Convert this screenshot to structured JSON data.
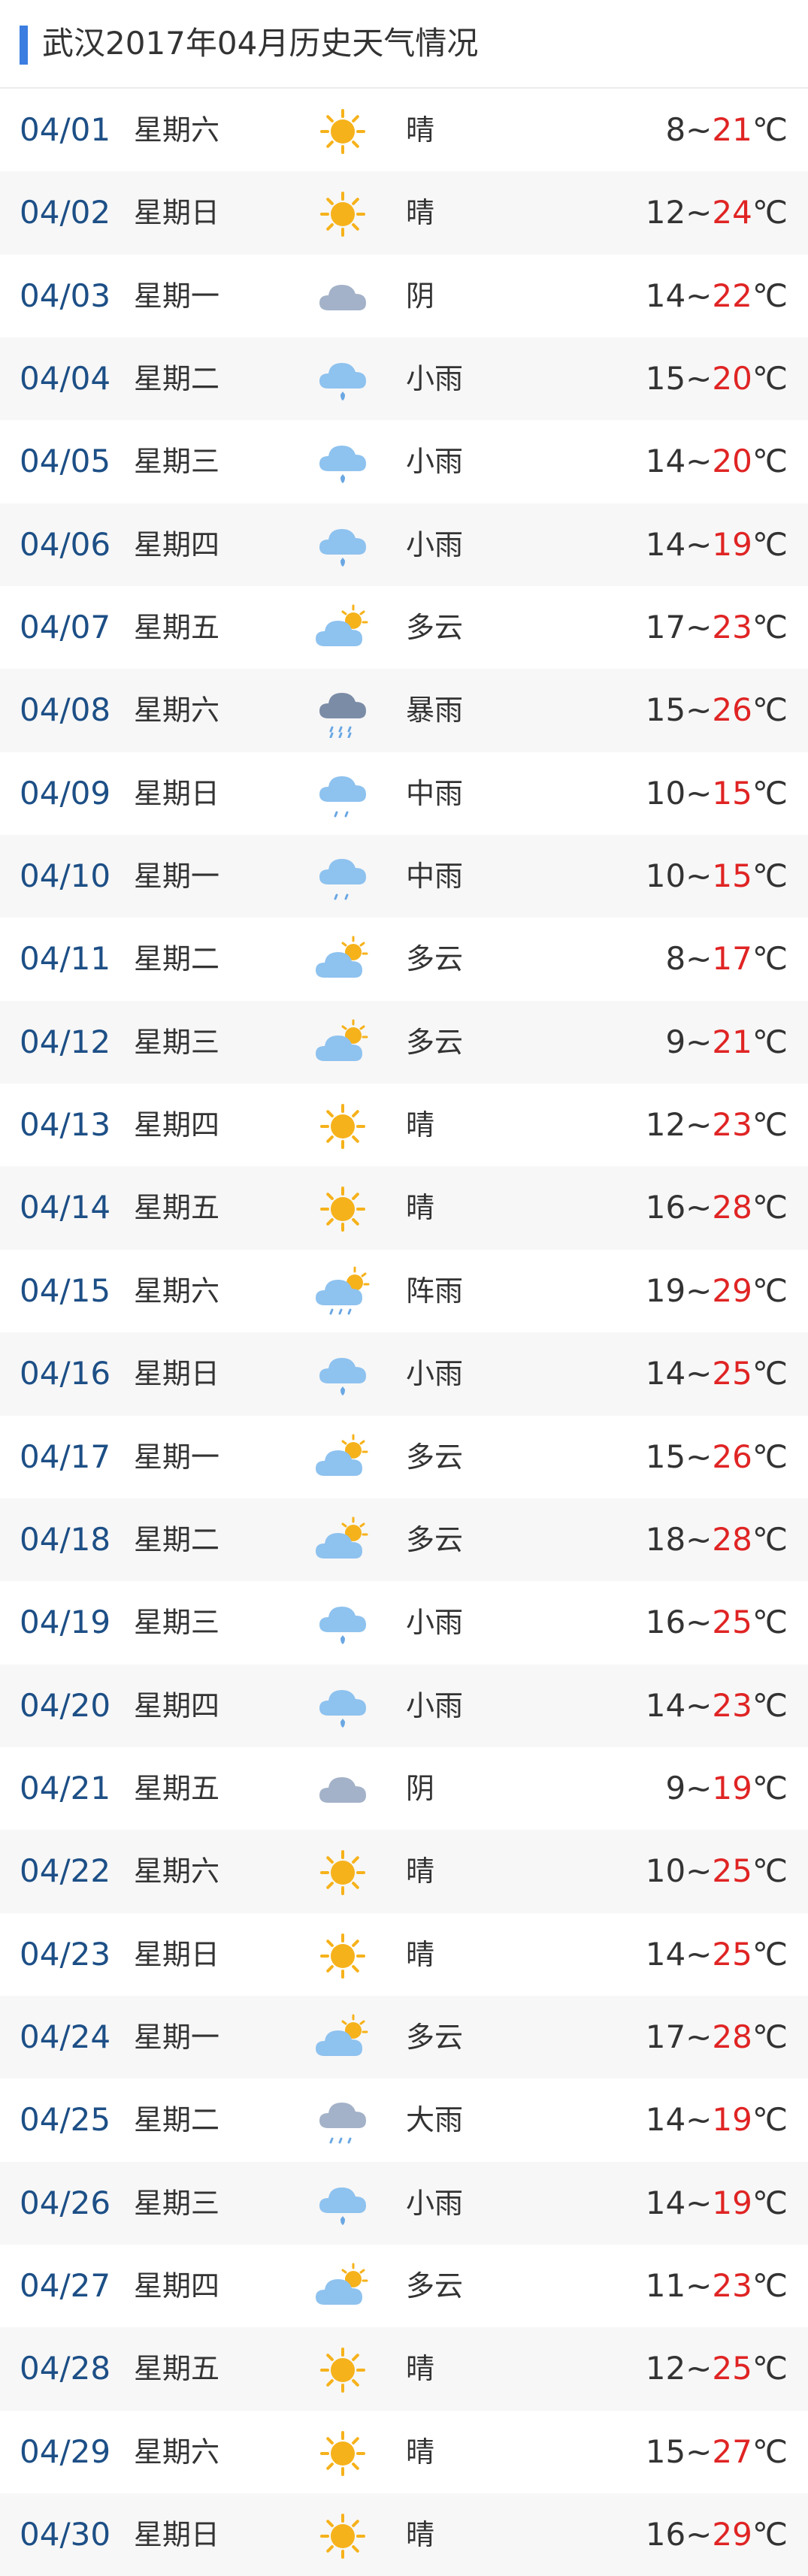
{
  "header": {
    "title": "武汉2017年04月历史天气情况"
  },
  "days": [
    {
      "date": "04/01",
      "week": "星期六",
      "icon": "sun-icon",
      "condition": "晴",
      "low": "8",
      "sep": "~",
      "high": "21",
      "unit": "℃"
    },
    {
      "date": "04/02",
      "week": "星期日",
      "icon": "sun-icon",
      "condition": "晴",
      "low": "12",
      "sep": "~",
      "high": "24",
      "unit": "℃"
    },
    {
      "date": "04/03",
      "week": "星期一",
      "icon": "overcast-cloud-icon",
      "condition": "阴",
      "low": "14",
      "sep": "~",
      "high": "22",
      "unit": "℃"
    },
    {
      "date": "04/04",
      "week": "星期二",
      "icon": "light-rain-icon",
      "condition": "小雨",
      "low": "15",
      "sep": "~",
      "high": "20",
      "unit": "℃"
    },
    {
      "date": "04/05",
      "week": "星期三",
      "icon": "light-rain-icon",
      "condition": "小雨",
      "low": "14",
      "sep": "~",
      "high": "20",
      "unit": "℃"
    },
    {
      "date": "04/06",
      "week": "星期四",
      "icon": "light-rain-icon",
      "condition": "小雨",
      "low": "14",
      "sep": "~",
      "high": "19",
      "unit": "℃"
    },
    {
      "date": "04/07",
      "week": "星期五",
      "icon": "partly-cloudy-icon",
      "condition": "多云",
      "low": "17",
      "sep": "~",
      "high": "23",
      "unit": "℃"
    },
    {
      "date": "04/08",
      "week": "星期六",
      "icon": "rainstorm-icon",
      "condition": "暴雨",
      "low": "15",
      "sep": "~",
      "high": "26",
      "unit": "℃"
    },
    {
      "date": "04/09",
      "week": "星期日",
      "icon": "moderate-rain-icon",
      "condition": "中雨",
      "low": "10",
      "sep": "~",
      "high": "15",
      "unit": "℃"
    },
    {
      "date": "04/10",
      "week": "星期一",
      "icon": "moderate-rain-icon",
      "condition": "中雨",
      "low": "10",
      "sep": "~",
      "high": "15",
      "unit": "℃"
    },
    {
      "date": "04/11",
      "week": "星期二",
      "icon": "partly-cloudy-icon",
      "condition": "多云",
      "low": "8",
      "sep": "~",
      "high": "17",
      "unit": "℃"
    },
    {
      "date": "04/12",
      "week": "星期三",
      "icon": "partly-cloudy-icon",
      "condition": "多云",
      "low": "9",
      "sep": "~",
      "high": "21",
      "unit": "℃"
    },
    {
      "date": "04/13",
      "week": "星期四",
      "icon": "sun-icon",
      "condition": "晴",
      "low": "12",
      "sep": "~",
      "high": "23",
      "unit": "℃"
    },
    {
      "date": "04/14",
      "week": "星期五",
      "icon": "sun-icon",
      "condition": "晴",
      "low": "16",
      "sep": "~",
      "high": "28",
      "unit": "℃"
    },
    {
      "date": "04/15",
      "week": "星期六",
      "icon": "shower-icon",
      "condition": "阵雨",
      "low": "19",
      "sep": "~",
      "high": "29",
      "unit": "℃"
    },
    {
      "date": "04/16",
      "week": "星期日",
      "icon": "light-rain-icon",
      "condition": "小雨",
      "low": "14",
      "sep": "~",
      "high": "25",
      "unit": "℃"
    },
    {
      "date": "04/17",
      "week": "星期一",
      "icon": "partly-cloudy-icon",
      "condition": "多云",
      "low": "15",
      "sep": "~",
      "high": "26",
      "unit": "℃"
    },
    {
      "date": "04/18",
      "week": "星期二",
      "icon": "partly-cloudy-icon",
      "condition": "多云",
      "low": "18",
      "sep": "~",
      "high": "28",
      "unit": "℃"
    },
    {
      "date": "04/19",
      "week": "星期三",
      "icon": "light-rain-icon",
      "condition": "小雨",
      "low": "16",
      "sep": "~",
      "high": "25",
      "unit": "℃"
    },
    {
      "date": "04/20",
      "week": "星期四",
      "icon": "light-rain-icon",
      "condition": "小雨",
      "low": "14",
      "sep": "~",
      "high": "23",
      "unit": "℃"
    },
    {
      "date": "04/21",
      "week": "星期五",
      "icon": "overcast-cloud-icon",
      "condition": "阴",
      "low": "9",
      "sep": "~",
      "high": "19",
      "unit": "℃"
    },
    {
      "date": "04/22",
      "week": "星期六",
      "icon": "sun-icon",
      "condition": "晴",
      "low": "10",
      "sep": "~",
      "high": "25",
      "unit": "℃"
    },
    {
      "date": "04/23",
      "week": "星期日",
      "icon": "sun-icon",
      "condition": "晴",
      "low": "14",
      "sep": "~",
      "high": "25",
      "unit": "℃"
    },
    {
      "date": "04/24",
      "week": "星期一",
      "icon": "partly-cloudy-icon",
      "condition": "多云",
      "low": "17",
      "sep": "~",
      "high": "28",
      "unit": "℃"
    },
    {
      "date": "04/25",
      "week": "星期二",
      "icon": "heavy-rain-icon",
      "condition": "大雨",
      "low": "14",
      "sep": "~",
      "high": "19",
      "unit": "℃"
    },
    {
      "date": "04/26",
      "week": "星期三",
      "icon": "light-rain-icon",
      "condition": "小雨",
      "low": "14",
      "sep": "~",
      "high": "19",
      "unit": "℃"
    },
    {
      "date": "04/27",
      "week": "星期四",
      "icon": "partly-cloudy-icon",
      "condition": "多云",
      "low": "11",
      "sep": "~",
      "high": "23",
      "unit": "℃"
    },
    {
      "date": "04/28",
      "week": "星期五",
      "icon": "sun-icon",
      "condition": "晴",
      "low": "12",
      "sep": "~",
      "high": "25",
      "unit": "℃"
    },
    {
      "date": "04/29",
      "week": "星期六",
      "icon": "sun-icon",
      "condition": "晴",
      "low": "15",
      "sep": "~",
      "high": "27",
      "unit": "℃"
    },
    {
      "date": "04/30",
      "week": "星期日",
      "icon": "sun-icon",
      "condition": "晴",
      "low": "16",
      "sep": "~",
      "high": "29",
      "unit": "℃"
    }
  ],
  "colors": {
    "accent_bar": "#3b7de0",
    "date_text": "#1d4f86",
    "high_temp": "#e02424",
    "alt_row_bg": "#f7f7f7",
    "sun": "#f6b21b",
    "cloud_light": "#8ec2ef",
    "cloud_gray": "#a3b2c8",
    "cloud_dark": "#7b8ca6",
    "rain_drop": "#6aa7e3"
  }
}
